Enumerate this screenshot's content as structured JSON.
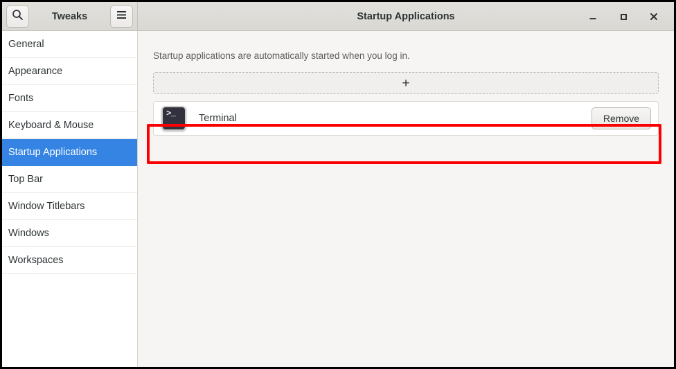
{
  "window": {
    "app_title": "Tweaks",
    "page_title": "Startup Applications",
    "search_icon": "search-icon",
    "menu_icon": "hamburger-menu-icon",
    "controls": {
      "minimize": "–",
      "maximize": "□",
      "close": "✕"
    }
  },
  "sidebar": {
    "items": [
      {
        "label": "General",
        "selected": false
      },
      {
        "label": "Appearance",
        "selected": false
      },
      {
        "label": "Fonts",
        "selected": false
      },
      {
        "label": "Keyboard & Mouse",
        "selected": false
      },
      {
        "label": "Startup Applications",
        "selected": true
      },
      {
        "label": "Top Bar",
        "selected": false
      },
      {
        "label": "Window Titlebars",
        "selected": false
      },
      {
        "label": "Windows",
        "selected": false
      },
      {
        "label": "Workspaces",
        "selected": false
      }
    ]
  },
  "main": {
    "description": "Startup applications are automatically started when you log in.",
    "add_button_label": "+",
    "apps": [
      {
        "name": "Terminal",
        "icon": "terminal-icon",
        "icon_glyph": ">_",
        "remove_label": "Remove"
      }
    ]
  },
  "annotation": {
    "highlight_color": "#fb0000"
  }
}
